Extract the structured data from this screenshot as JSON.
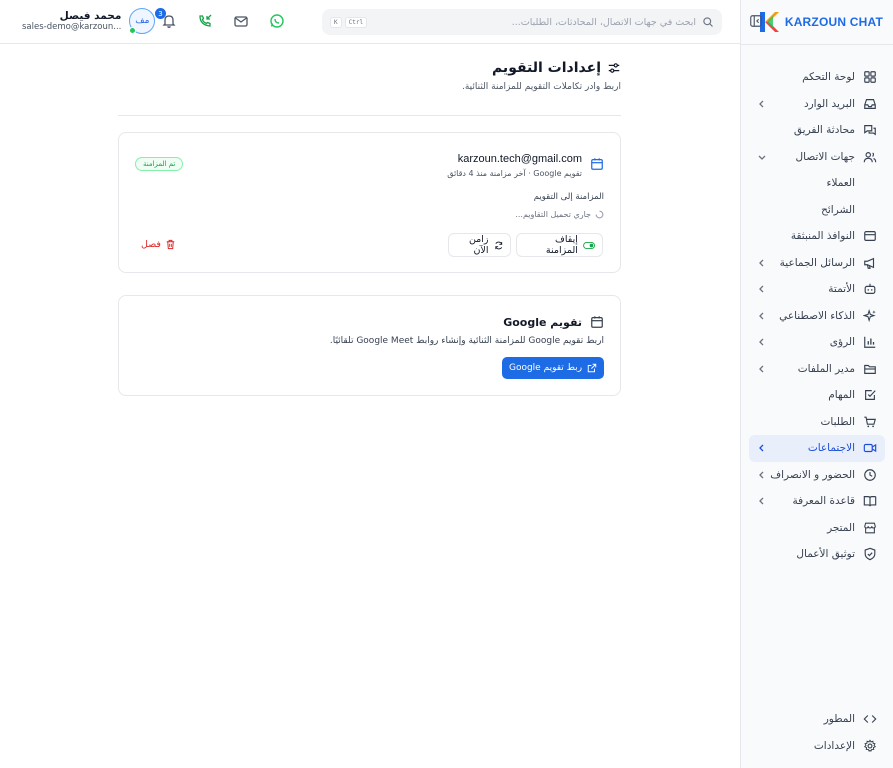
{
  "brand": {
    "name": "KARZOUN CHAT",
    "accent": "#1e6be6"
  },
  "search": {
    "placeholder": "ابحث في جهات الاتصال، المحادثات، الطلبات...",
    "shortcut_key1": "Ctrl",
    "shortcut_key2": "K"
  },
  "notifications": {
    "count": "3"
  },
  "user": {
    "name": "محمد فيصل",
    "email": "sales-demo@karzoun...",
    "initials": "مف"
  },
  "sidebar": {
    "items": [
      {
        "label": "لوحة التحكم",
        "icon": "dashboard-icon"
      },
      {
        "label": "البريد الوارد",
        "icon": "inbox-icon"
      },
      {
        "label": "محادثة الفريق",
        "icon": "team-chat-icon"
      },
      {
        "label": "جهات الاتصال",
        "icon": "contacts-icon"
      },
      {
        "label": "العملاء"
      },
      {
        "label": "الشرائح"
      },
      {
        "label": "النوافذ المنبثقة",
        "icon": "popup-icon"
      },
      {
        "label": "الرسائل الجماعية",
        "icon": "megaphone-icon"
      },
      {
        "label": "الأتمتة",
        "icon": "bot-icon"
      },
      {
        "label": "الذكاء الاصطناعي",
        "icon": "sparkles-icon"
      },
      {
        "label": "الرؤى",
        "icon": "bar-chart-icon"
      },
      {
        "label": "مدير الملفات",
        "icon": "folder-icon"
      },
      {
        "label": "المهام",
        "icon": "task-icon"
      },
      {
        "label": "الطلبات",
        "icon": "cart-icon"
      },
      {
        "label": "الاجتماعات",
        "icon": "video-icon"
      },
      {
        "label": "الحضور و الانصراف",
        "icon": "clock-icon"
      },
      {
        "label": "قاعدة المعرفة",
        "icon": "book-icon"
      },
      {
        "label": "المتجر",
        "icon": "store-icon"
      },
      {
        "label": "توثيق الأعمال",
        "icon": "shield-check-icon"
      }
    ],
    "bottom": [
      {
        "label": "المطور",
        "icon": "code-icon"
      },
      {
        "label": "الإعدادات",
        "icon": "settings-icon"
      }
    ]
  },
  "page": {
    "title": "إعدادات التقويم",
    "subtitle": "اربط وادر تكاملات التقويم للمزامنة الثنائية."
  },
  "connected_calendar": {
    "email": "karzoun.tech@gmail.com",
    "meta": "تقويم Google · آخر مزامنة منذ 4 دقائق",
    "status_badge": "تم المزامنة",
    "sync_to_label": "المزامنة إلى التقويم",
    "loading_text": "جاري تحميل التقاويم...",
    "stop_sync_label": "إيقاف المزامنة",
    "sync_now_label": "زامن الآن",
    "disconnect_label": "فصل"
  },
  "google_card": {
    "title": "تقويم Google",
    "description": "اربط تقويم Google للمزامنة الثنائية وإنشاء روابط Google Meet تلقائيًا.",
    "connect_label": "ربط تقويم Google"
  }
}
